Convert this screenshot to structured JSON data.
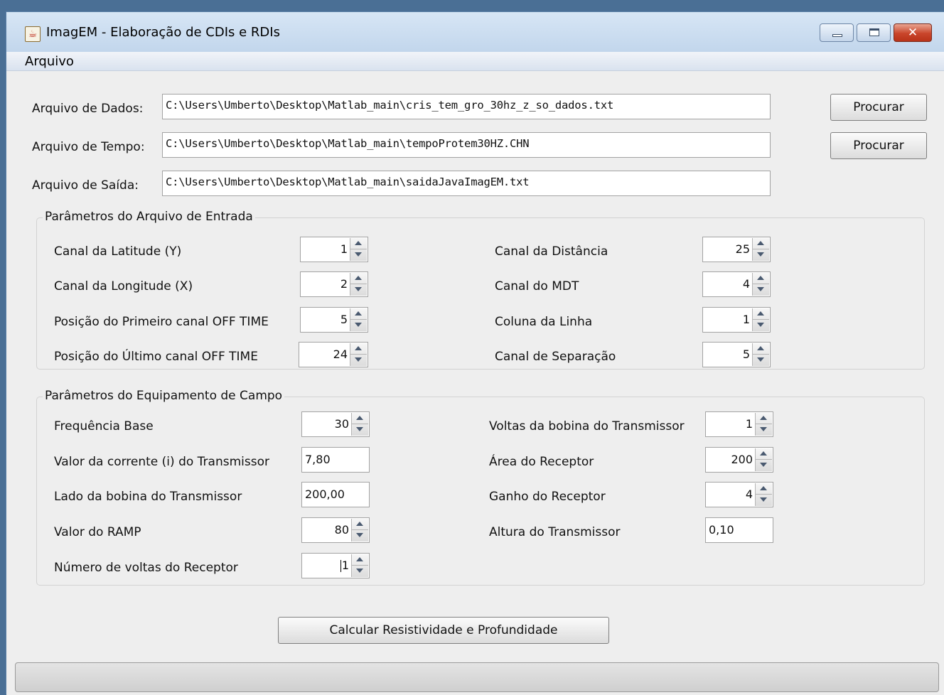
{
  "window": {
    "title": "ImagEM - Elaboração de CDIs e RDIs",
    "icon": "java-cup-icon",
    "controls": [
      "minimize-icon",
      "maximize-icon",
      "close-icon"
    ],
    "close_glyph": "✕"
  },
  "menu": {
    "arquivo": "Arquivo"
  },
  "files": {
    "dados": {
      "label": "Arquivo de Dados:",
      "value": "C:\\Users\\Umberto\\Desktop\\Matlab_main\\cris_tem_gro_30hz_z_so_dados.txt",
      "button": "Procurar"
    },
    "tempo": {
      "label": "Arquivo de Tempo:",
      "value": "C:\\Users\\Umberto\\Desktop\\Matlab_main\\tempoProtem30HZ.CHN",
      "button": "Procurar"
    },
    "saida": {
      "label": "Arquivo de Saída:",
      "value": "C:\\Users\\Umberto\\Desktop\\Matlab_main\\saidaJavaImagEM.txt"
    }
  },
  "entrada": {
    "title": "Parâmetros do Arquivo de Entrada",
    "left": [
      {
        "label": "Canal da Latitude (Y)",
        "value": "1"
      },
      {
        "label": "Canal da Longitude (X)",
        "value": "2"
      },
      {
        "label": "Posição do Primeiro canal OFF TIME",
        "value": "5"
      },
      {
        "label": "Posição do Último canal OFF TIME",
        "value": "24"
      }
    ],
    "right": [
      {
        "label": "Canal da Distância",
        "value": "25"
      },
      {
        "label": "Canal do MDT",
        "value": "4"
      },
      {
        "label": "Coluna da Linha",
        "value": "1"
      },
      {
        "label": "Canal de Separação",
        "value": "5"
      }
    ]
  },
  "equipamento": {
    "title": "Parâmetros do Equipamento de Campo",
    "left": [
      {
        "label": "Frequência Base",
        "value": "30"
      },
      {
        "label": "Valor da corrente (i) do Transmissor",
        "value": "7,80"
      },
      {
        "label": "Lado da bobina do Transmissor",
        "value": "200,00"
      },
      {
        "label": "Valor do RAMP",
        "value": "80"
      },
      {
        "label": "Número de voltas do Receptor",
        "value": "1"
      }
    ],
    "right": [
      {
        "label": "Voltas da bobina do Transmissor",
        "value": "1"
      },
      {
        "label": "Área do Receptor",
        "value": "200"
      },
      {
        "label": "Ganho do Receptor",
        "value": "4"
      },
      {
        "label": "Altura do Transmissor",
        "value": "0,10"
      }
    ]
  },
  "actions": {
    "calcular": "Calcular Resistividade e Profundidade"
  },
  "status": {
    "text": ""
  }
}
